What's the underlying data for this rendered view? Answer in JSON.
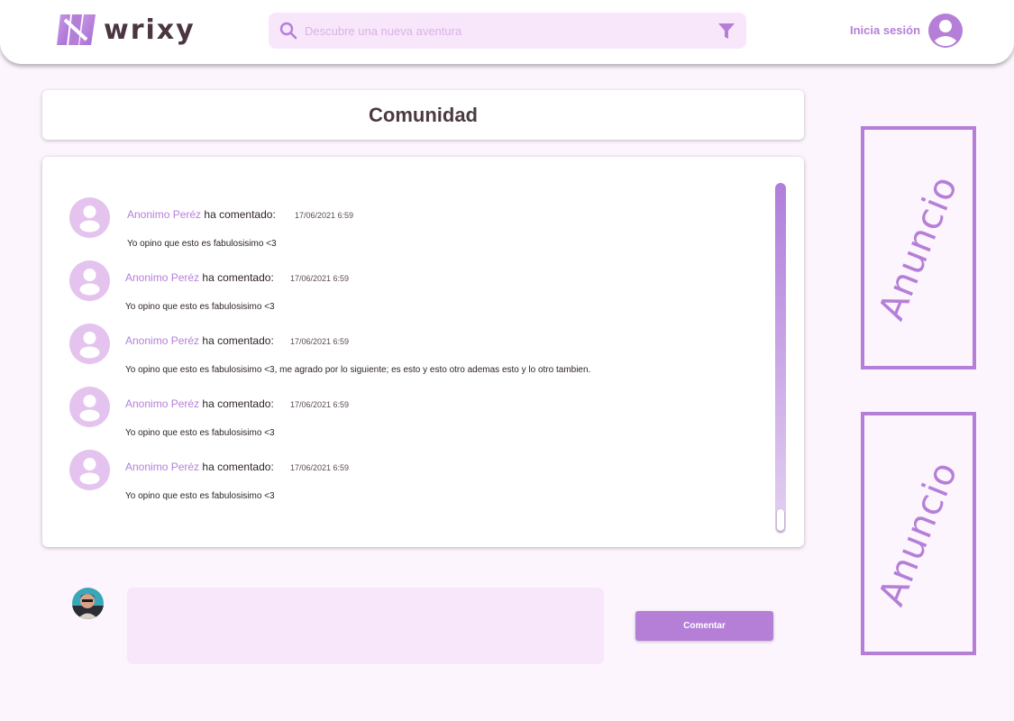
{
  "header": {
    "brand": "wrixy",
    "search_placeholder": "Descubre una nueva aventura",
    "login_label": "Inicia sesión",
    "icons": {
      "search": "search-icon",
      "filter": "filter-icon",
      "user": "user-icon"
    },
    "accent_color": "#b57fd8"
  },
  "page": {
    "title": "Comunidad"
  },
  "comments": [
    {
      "author": "Anonimo Peréz",
      "verb": "ha comentado:",
      "time": "17/06/2021 6:59",
      "text": "Yo opino que esto es fabulosisimo <3"
    },
    {
      "author": "Anonimo Peréz",
      "verb": "ha comentado:",
      "time": "17/06/2021 6:59",
      "text": "Yo opino que esto es fabulosisimo <3"
    },
    {
      "author": "Anonimo Peréz",
      "verb": "ha comentado:",
      "time": "17/06/2021 6:59",
      "text": "Yo opino que esto es fabulosisimo <3, me agrado por lo siguiente; es esto y esto otro ademas esto y lo otro tambien."
    },
    {
      "author": "Anonimo Peréz",
      "verb": "ha comentado:",
      "time": "17/06/2021 6:59",
      "text": "Yo opino que esto es fabulosisimo <3"
    },
    {
      "author": "Anonimo Peréz",
      "verb": "ha comentado:",
      "time": "17/06/2021 6:59",
      "text": "Yo opino que esto es fabulosisimo <3"
    }
  ],
  "composer": {
    "button_label": "Comentar",
    "input_value": ""
  },
  "ads": [
    {
      "label": "Anuncio"
    },
    {
      "label": "Anuncio"
    }
  ]
}
